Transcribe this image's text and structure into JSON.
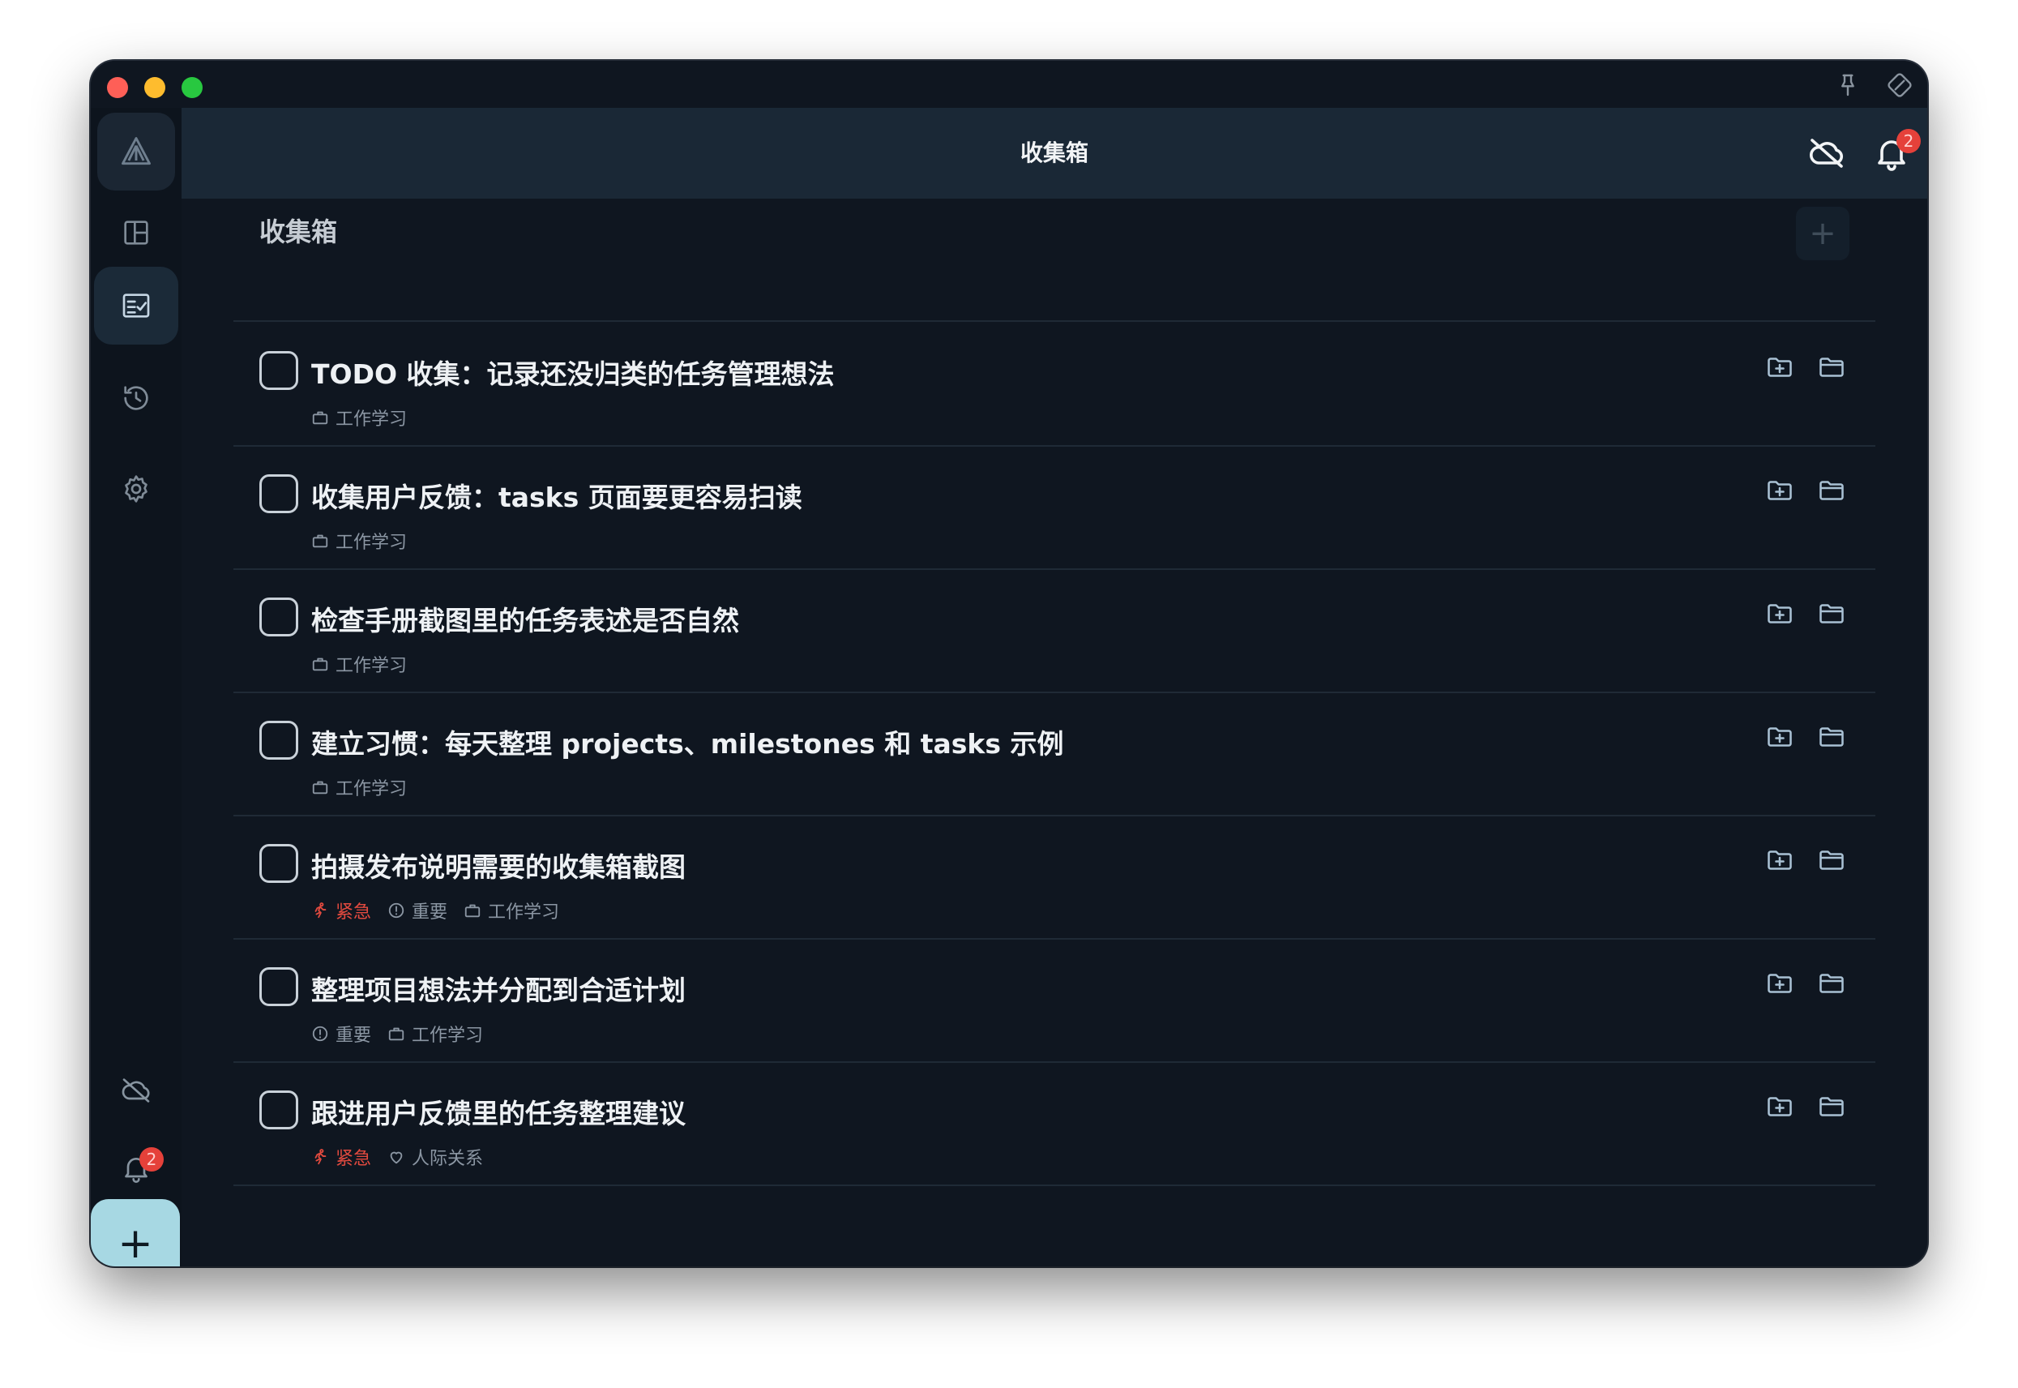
{
  "window": {
    "title": "收集箱"
  },
  "sidebar": {
    "items": [
      {
        "name": "dashboard",
        "icon": "layout-icon"
      },
      {
        "name": "inbox",
        "icon": "checklist-icon",
        "active": true
      },
      {
        "name": "history",
        "icon": "history-icon"
      },
      {
        "name": "settings",
        "icon": "gear-icon"
      }
    ],
    "bottom": {
      "cloud_icon": "cloud-off-icon",
      "notification_badge": "2"
    },
    "add_button": "+"
  },
  "header": {
    "title": "收集箱",
    "notification_badge": "2"
  },
  "section": {
    "title": "收集箱",
    "add_label": "+"
  },
  "tasks": [
    {
      "title": "TODO 收集：记录还没归类的任务管理想法",
      "tags": [
        {
          "type": "area",
          "label": "工作学习"
        }
      ]
    },
    {
      "title": "收集用户反馈：tasks 页面要更容易扫读",
      "tags": [
        {
          "type": "area",
          "label": "工作学习"
        }
      ]
    },
    {
      "title": "检查手册截图里的任务表述是否自然",
      "tags": [
        {
          "type": "area",
          "label": "工作学习"
        }
      ]
    },
    {
      "title": "建立习惯：每天整理 projects、milestones 和 tasks 示例",
      "tags": [
        {
          "type": "area",
          "label": "工作学习"
        }
      ]
    },
    {
      "title": "拍摄发布说明需要的收集箱截图",
      "tags": [
        {
          "type": "urgent",
          "label": "紧急"
        },
        {
          "type": "important",
          "label": "重要"
        },
        {
          "type": "area",
          "label": "工作学习"
        }
      ]
    },
    {
      "title": "整理项目想法并分配到合适计划",
      "tags": [
        {
          "type": "important",
          "label": "重要"
        },
        {
          "type": "area",
          "label": "工作学习"
        }
      ]
    },
    {
      "title": "跟进用户反馈里的任务整理建议",
      "tags": [
        {
          "type": "urgent",
          "label": "紧急"
        },
        {
          "type": "heart",
          "label": "人际关系"
        }
      ]
    }
  ],
  "colors": {
    "background": "#0f1620",
    "header": "#1a2836",
    "accent": "#a7d8e3",
    "urgent": "#e24a3f",
    "badge": "#e5413a"
  }
}
